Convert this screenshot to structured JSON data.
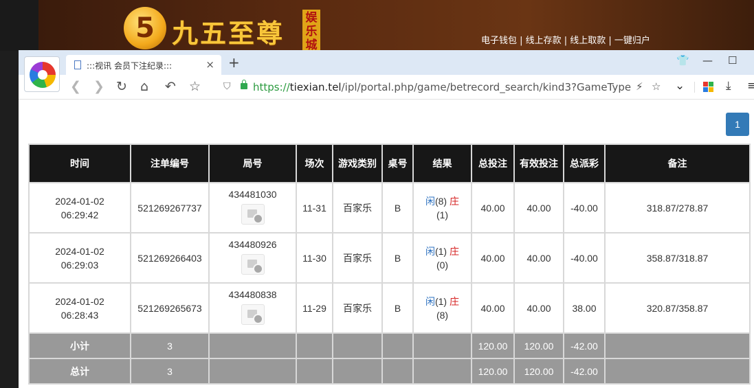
{
  "site": {
    "logo_glyph": "5",
    "logo_text": "九五至尊",
    "logo_tag": "娱乐城",
    "nav": "电子钱包 | 线上存款 | 线上取款 | 一键归户"
  },
  "browser": {
    "tab_title": ":::视讯 会员下注纪录:::",
    "tab_close": "×",
    "new_tab": "+",
    "url_scheme": "https://",
    "url_host": "tiexian.tel",
    "url_path": "/ipl/portal.php/game/betrecord_search/kind3?GameType",
    "icons": {
      "back": "❮",
      "forward": "❯",
      "reload": "↻",
      "home": "⌂",
      "undo": "↶",
      "star": "☆",
      "shield": "⛉",
      "bolt": "⚡",
      "bookmark": "☆",
      "dropdown": "⌄",
      "download": "⤓",
      "menu": "≡",
      "shirt": "👕",
      "minimize": "—",
      "maximize": "☐"
    },
    "colors": {
      "tabstrip": "#dde8f5",
      "secure": "#2a9a3e"
    }
  },
  "pager": {
    "current": "1"
  },
  "table": {
    "headers": [
      "时间",
      "注单编号",
      "局号",
      "场次",
      "游戏类别",
      "桌号",
      "结果",
      "总投注",
      "有效投注",
      "总派彩",
      "备注"
    ],
    "rows": [
      {
        "date": "2024-01-02",
        "time": "06:29:42",
        "order": "521269267737",
        "round": "434481030",
        "session": "11-31",
        "game": "百家乐",
        "table": "B",
        "res_player": "闲",
        "res_player_n": "(8)",
        "res_banker": "庄",
        "res_banker_n": "(1)",
        "bet": "40.00",
        "valid": "40.00",
        "payout": "-40.00",
        "note": "318.87/278.87"
      },
      {
        "date": "2024-01-02",
        "time": "06:29:03",
        "order": "521269266403",
        "round": "434480926",
        "session": "11-30",
        "game": "百家乐",
        "table": "B",
        "res_player": "闲",
        "res_player_n": "(1)",
        "res_banker": "庄",
        "res_banker_n": "(0)",
        "bet": "40.00",
        "valid": "40.00",
        "payout": "-40.00",
        "note": "358.87/318.87"
      },
      {
        "date": "2024-01-02",
        "time": "06:28:43",
        "order": "521269265673",
        "round": "434480838",
        "session": "11-29",
        "game": "百家乐",
        "table": "B",
        "res_player": "闲",
        "res_player_n": "(1)",
        "res_banker": "庄",
        "res_banker_n": "(8)",
        "bet": "40.00",
        "valid": "40.00",
        "payout": "38.00",
        "note": "320.87/358.87"
      }
    ],
    "subtotal": {
      "label": "小计",
      "count": "3",
      "bet": "120.00",
      "valid": "120.00",
      "payout": "-42.00"
    },
    "total": {
      "label": "总计",
      "count": "3",
      "bet": "120.00",
      "valid": "120.00",
      "payout": "-42.00"
    }
  }
}
